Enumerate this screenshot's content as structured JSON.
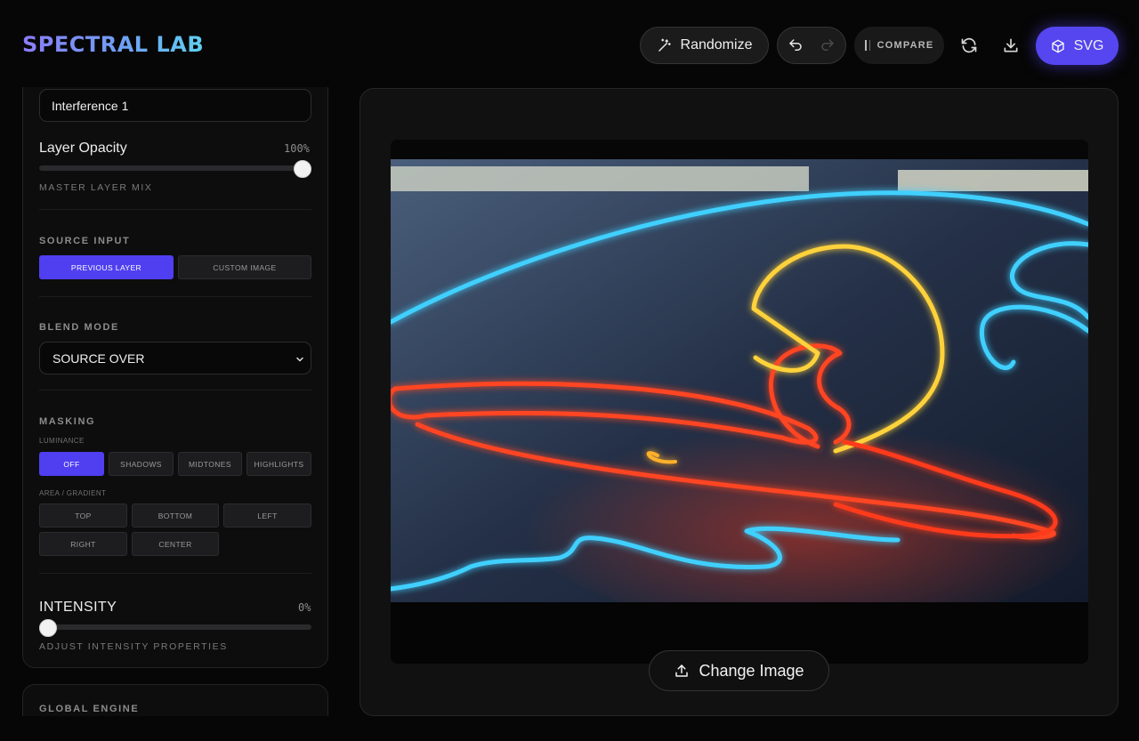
{
  "app": {
    "title": "SPECTRAL LAB"
  },
  "toolbar": {
    "randomize_label": "Randomize",
    "compare_label": "COMPARE",
    "export_label": "SVG"
  },
  "layer": {
    "name": "Interference 1",
    "opacity_label": "Layer Opacity",
    "opacity_value": "100%",
    "opacity_fraction": 1.0,
    "opacity_sub": "MASTER LAYER MIX"
  },
  "source": {
    "heading": "SOURCE INPUT",
    "options": [
      "PREVIOUS LAYER",
      "CUSTOM IMAGE"
    ],
    "selected": "PREVIOUS LAYER"
  },
  "blend": {
    "heading": "BLEND MODE",
    "selected": "SOURCE OVER"
  },
  "masking": {
    "heading": "MASKING",
    "luminance_label": "LUMINANCE",
    "luminance_options": [
      "OFF",
      "SHADOWS",
      "MIDTONES",
      "HIGHLIGHTS"
    ],
    "luminance_selected": "OFF",
    "area_label": "AREA / GRADIENT",
    "area_options": [
      "TOP",
      "BOTTOM",
      "LEFT",
      "RIGHT",
      "CENTER"
    ]
  },
  "intensity": {
    "label": "INTENSITY",
    "value": "0%",
    "fraction": 0.0,
    "sub": "ADJUST INTENSITY PROPERTIES"
  },
  "global": {
    "heading": "GLOBAL ENGINE"
  },
  "canvas": {
    "change_image_label": "Change Image"
  },
  "colors": {
    "accent": "#5546f0",
    "neon_red": "#ff3a1a",
    "neon_yellow": "#ffd23a",
    "neon_blue": "#37c8ff"
  }
}
